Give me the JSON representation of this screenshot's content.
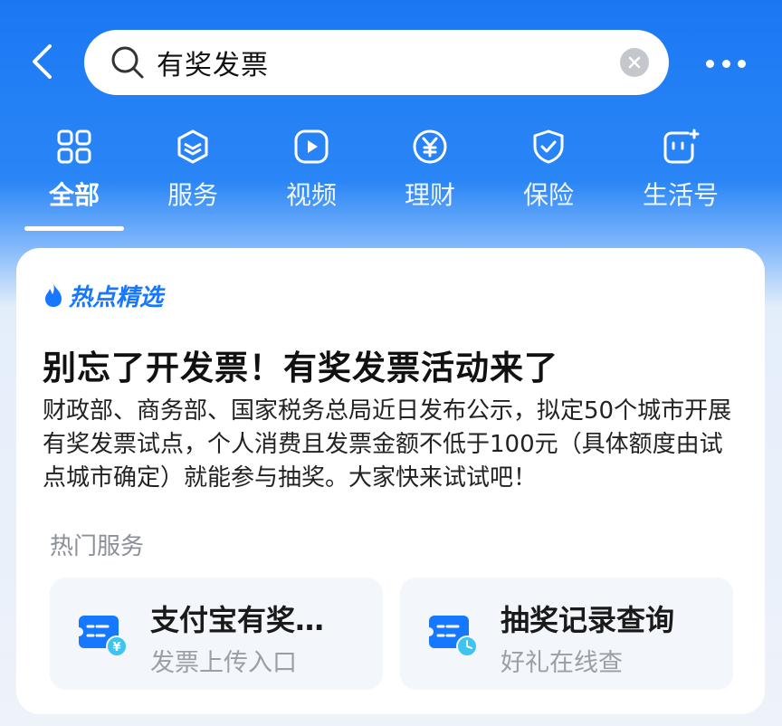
{
  "search": {
    "query": "有奖发票"
  },
  "tabs": [
    {
      "label": "全部",
      "icon": "grid-icon",
      "active": true
    },
    {
      "label": "服务",
      "icon": "cube-icon"
    },
    {
      "label": "视频",
      "icon": "play-icon"
    },
    {
      "label": "理财",
      "icon": "yen-icon"
    },
    {
      "label": "保险",
      "icon": "shield-icon"
    },
    {
      "label": "生活号",
      "icon": "chat-face-icon"
    }
  ],
  "card": {
    "tag": "热点精选",
    "headline": "别忘了开发票！有奖发票活动来了",
    "summary": "财政部、商务部、国家税务总局近日发布公示，拟定50个城市开展有奖发票试点，个人消费且发票金额不低于100元（具体额度由试点城市确定）就能参与抽奖。大家快来试试吧！",
    "section_title": "热门服务",
    "services": [
      {
        "title": "支付宝有奖…",
        "subtitle": "发票上传入口",
        "icon": "ticket-yen-icon"
      },
      {
        "title": "抽奖记录查询",
        "subtitle": "好礼在线查",
        "icon": "ticket-clock-icon"
      }
    ]
  },
  "colors": {
    "brand": "#1677ff",
    "header": "#1b78f3"
  }
}
